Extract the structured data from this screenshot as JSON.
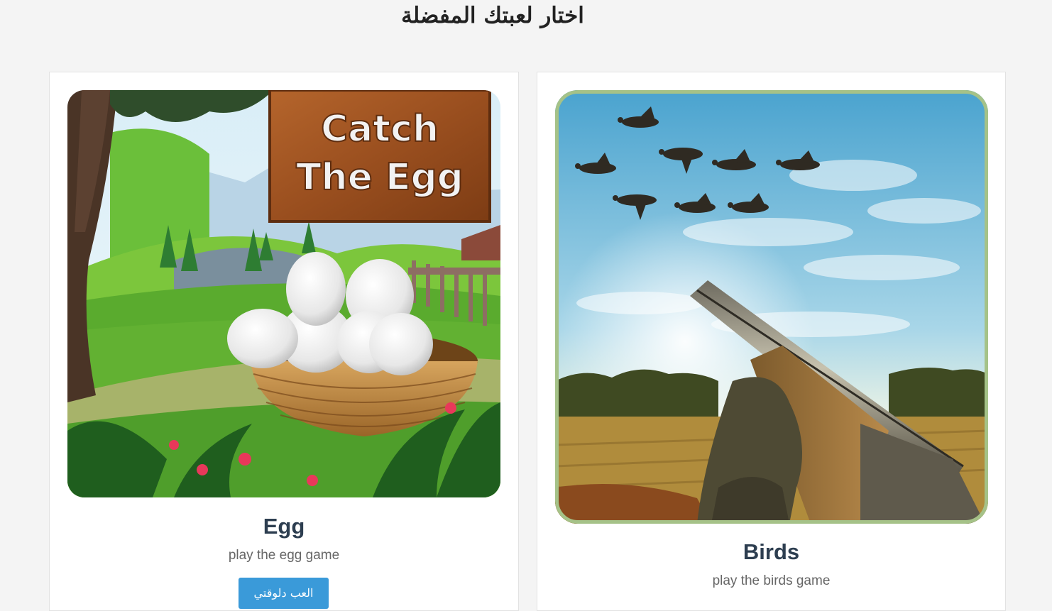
{
  "page": {
    "title": "اختار لعبتك المفضلة"
  },
  "games": [
    {
      "name": "Egg",
      "description": "play the egg game",
      "button_label": "العب دلوقتي",
      "art": {
        "sign_line1": "Catch",
        "sign_line2": "The Egg"
      }
    },
    {
      "name": "Birds",
      "description": "play the birds game"
    }
  ],
  "colors": {
    "background": "#f4f4f4",
    "card": "#ffffff",
    "title_text": "#2d3e50",
    "button": "#3a9ad9",
    "birds_frame": "#a5c288"
  }
}
